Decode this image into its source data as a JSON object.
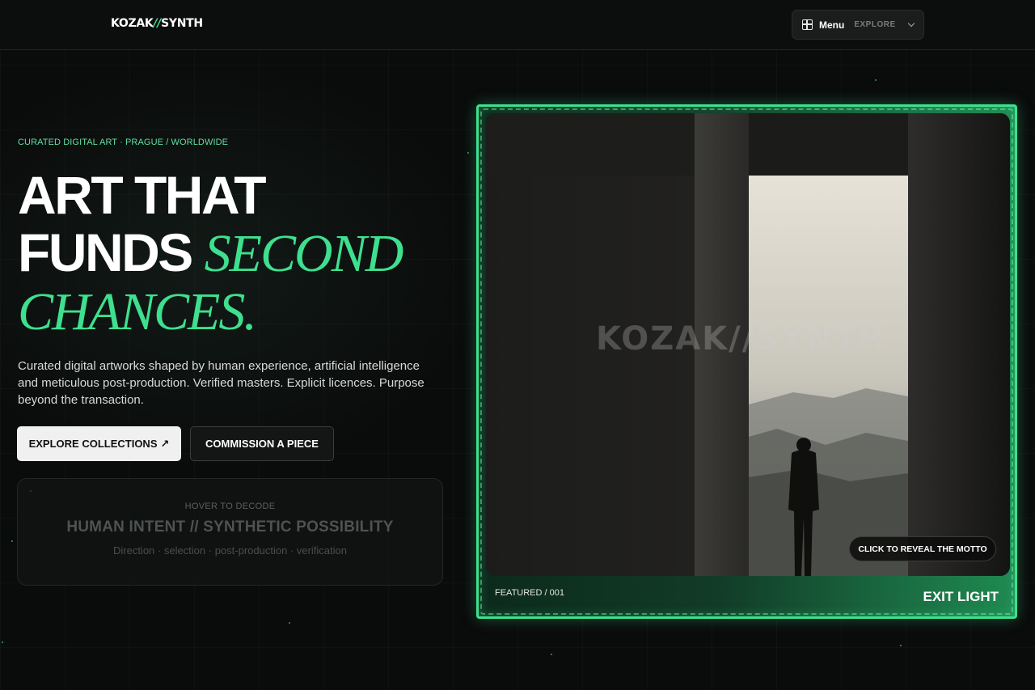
{
  "header": {
    "logo_left": "KOZAK",
    "logo_slash": "//",
    "logo_right": "SYNTH",
    "menu_label": "Menu",
    "menu_sub": "EXPLORE"
  },
  "hero": {
    "eyebrow": "CURATED DIGITAL ART · PRAGUE / WORLDWIDE",
    "headline_line1": "ART THAT",
    "headline_line2_plain": "FUNDS ",
    "headline_line2_accent": "SECOND",
    "headline_line3_accent": "CHANCES.",
    "description": "Curated digital artworks shaped by human experience, artificial intelligence and meticulous post-production. Verified masters. Explicit licences. Purpose beyond the transaction.",
    "primary_button": "EXPLORE COLLECTIONS",
    "primary_button_arrow": "↗",
    "secondary_button": "COMMISSION A PIECE"
  },
  "decode_card": {
    "hint": "HOVER TO DECODE",
    "title": "HUMAN INTENT // SYNTHETIC POSSIBILITY",
    "subtitle": "Direction · selection · post-production · verification"
  },
  "featured": {
    "watermark": "KOZAK//SYNTH",
    "motto_button": "CLICK TO REVEAL THE MOTTO",
    "label": "FEATURED / 001",
    "title": "EXIT LIGHT"
  },
  "colors": {
    "accent": "#3ee08f",
    "background": "#0a0b0b",
    "primary_button_bg": "#f0f0f0"
  }
}
